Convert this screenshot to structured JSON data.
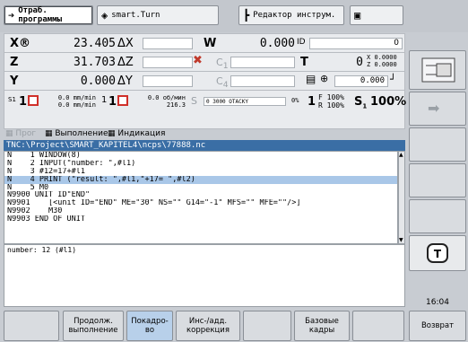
{
  "tabs": [
    {
      "label": "Отраб. программы",
      "icon": "arrow-right-icon",
      "active": true
    },
    {
      "label": "smart.Turn",
      "icon": "diamond-arrow-icon",
      "active": false
    },
    {
      "label": "Редактор инструм.",
      "icon": "tool-icon",
      "active": false
    },
    {
      "label": "",
      "icon": "calculator-icon",
      "active": false
    }
  ],
  "axes": {
    "x": {
      "label": "X®",
      "value": "23.405",
      "delta": "ΔX"
    },
    "z": {
      "label": "Z",
      "value": "31.703",
      "delta": "ΔZ"
    },
    "y": {
      "label": "Y",
      "value": "0.000",
      "delta": "ΔY"
    },
    "w": {
      "label": "W",
      "value": "0.000",
      "id_label": "ID",
      "id_value": "0"
    },
    "c1": "C",
    "c4": "C",
    "t": {
      "label": "T",
      "value": "0",
      "x_val": "0.0000",
      "z_val": "0.0000"
    },
    "spindle_val": "0.000"
  },
  "feed": {
    "s1_label": "S1",
    "s1_num": "1",
    "mm_min_1": "0.0 mm/min",
    "mm_min_2": "0.0 mm/min",
    "num": "1",
    "num2": "1",
    "mm_rev": "0.0 об/мин",
    "rev2": "216.3",
    "s_label": "S",
    "scale": "0 3000 OTACKY",
    "pct0": "0%",
    "f_num": "1",
    "f_label": "F 100%",
    "r_label": "R 100%",
    "s1_final": "S",
    "s1_sub": "1",
    "pct_final": "100%"
  },
  "modes": {
    "prog": "Прог",
    "exec": "Выполнение",
    "ind": "Индикация"
  },
  "path": "TNC:\\Project\\SMART_KAPITEL4\\ncps\\77888.nc",
  "lines": [
    "N    1 WINDOW(8)",
    "N    2 INPUT(\"number: \",#l1)",
    "N    3 #12=17+#l1",
    "N    4 PRINT (\"result: \",#l1,\"+17= \",#l2)",
    "N    5 M0",
    "N9900 UNIT ID\"END\"",
    "N9901    [<unit ID=\"END\" ME=\"30\" NS=\"\" G14=\"-1\" MFS=\"\" MFE=\"\"/>]",
    "N9902    M30",
    "N9903 END OF UNIT"
  ],
  "selected_line": 3,
  "message": "number: 12 (#l1)",
  "clock": "16:04",
  "softkeys": [
    "",
    "Продолж.\nвыполнение",
    "Покадро-\nво",
    "Инс-/адд.\nкоррекция",
    "",
    "Базовые\nкадры",
    "",
    "Возврат"
  ]
}
